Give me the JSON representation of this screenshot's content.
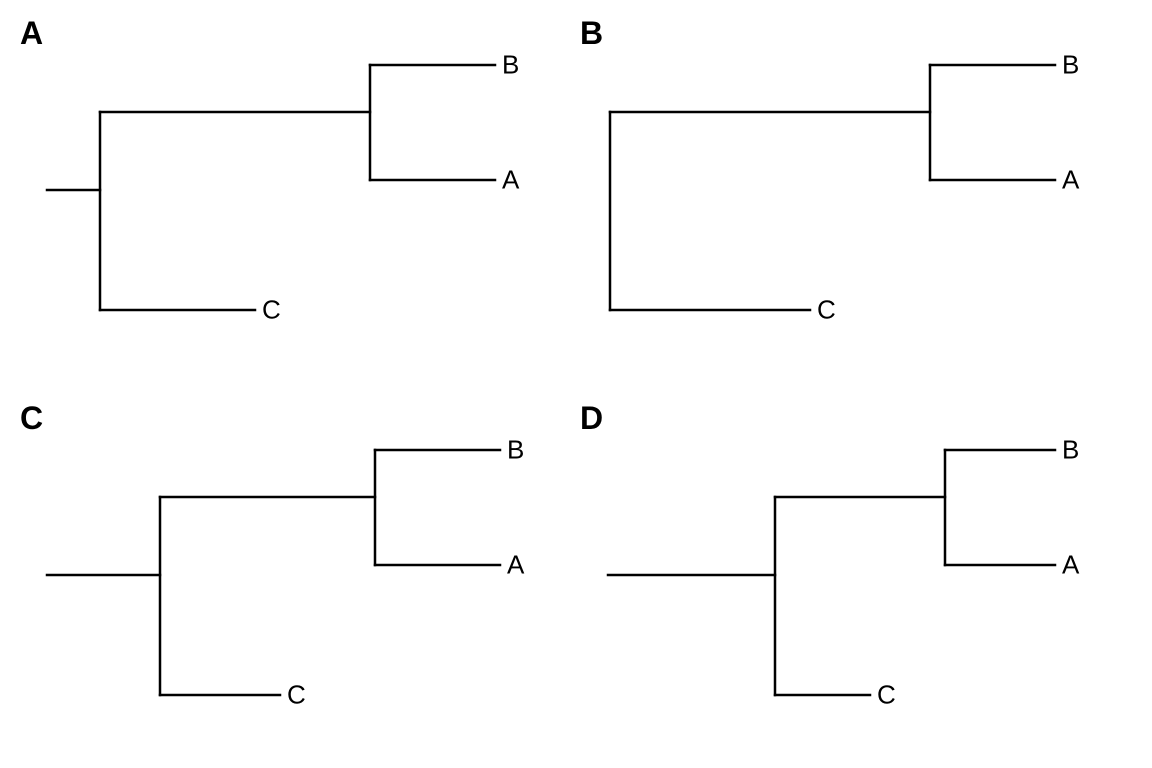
{
  "panels": {
    "A": {
      "label": "A",
      "tips": {
        "B": "B",
        "A": "A",
        "C": "C"
      }
    },
    "B": {
      "label": "B",
      "tips": {
        "B": "B",
        "A": "A",
        "C": "C"
      }
    },
    "C": {
      "label": "C",
      "tips": {
        "B": "B",
        "A": "A",
        "C": "C"
      }
    },
    "D": {
      "label": "D",
      "tips": {
        "B": "B",
        "A": "A",
        "C": "C"
      }
    }
  },
  "chart_data": [
    {
      "type": "tree",
      "panel": "A",
      "description": "Rooted phylogenetic tree with short root stem",
      "tips": [
        "B",
        "A",
        "C"
      ],
      "topology": "(C,(A,B))",
      "root_stem_relative": 0.1,
      "branch_C_relative": 0.3,
      "internal_to_AB_relative": 0.55,
      "tip_AB_relative": 0.25
    },
    {
      "type": "tree",
      "panel": "B",
      "description": "Unrooted/zero-stem phylogenetic tree (no outgroup stem drawn)",
      "tips": [
        "B",
        "A",
        "C"
      ],
      "topology": "(C,(A,B))",
      "root_stem_relative": 0.0,
      "branch_C_relative": 0.38,
      "internal_to_AB_relative": 0.62,
      "tip_AB_relative": 0.25
    },
    {
      "type": "tree",
      "panel": "C",
      "description": "Rooted phylogenetic tree with medium root stem",
      "tips": [
        "B",
        "A",
        "C"
      ],
      "topology": "(C,(A,B))",
      "root_stem_relative": 0.22,
      "branch_C_relative": 0.23,
      "internal_to_AB_relative": 0.45,
      "tip_AB_relative": 0.25
    },
    {
      "type": "tree",
      "panel": "D",
      "description": "Rooted phylogenetic tree with long root stem",
      "tips": [
        "B",
        "A",
        "C"
      ],
      "topology": "(C,(A,B))",
      "root_stem_relative": 0.34,
      "branch_C_relative": 0.2,
      "internal_to_AB_relative": 0.34,
      "tip_AB_relative": 0.22
    }
  ]
}
